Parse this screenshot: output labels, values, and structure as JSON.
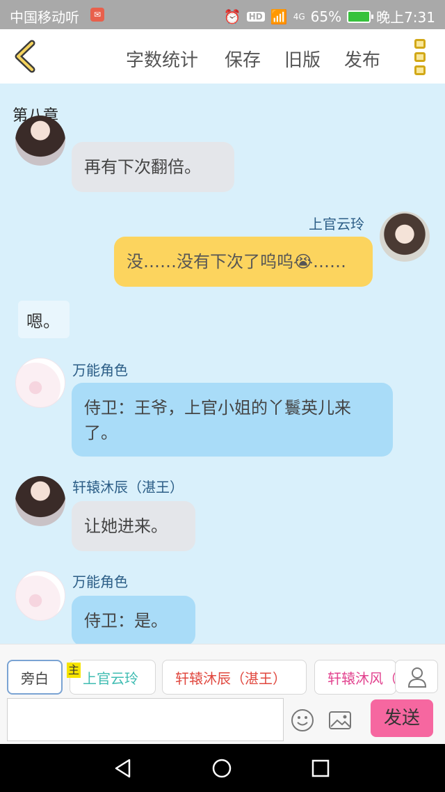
{
  "status_bar": {
    "carrier": "中国移动听",
    "hd": "HD",
    "network": "4G",
    "battery": "65%",
    "time": "晚上7:31"
  },
  "header": {
    "actions": [
      "字数统计",
      "保存",
      "旧版",
      "发布"
    ]
  },
  "chapter_title": "第八章",
  "messages": [
    {
      "text": "再有下次翻倍。"
    },
    {
      "name": "上官云玲",
      "text": "没……没有下次了呜呜😭……"
    },
    {
      "text": "嗯。"
    },
    {
      "name": "万能角色",
      "text": "侍卫：王爷，上官小姐的丫鬟英儿来了。"
    },
    {
      "name": "轩辕沐辰（湛王）",
      "text": "让她进来。"
    },
    {
      "name": "万能角色",
      "text": "侍卫：是。"
    }
  ],
  "roles": [
    {
      "label": "旁白"
    },
    {
      "label": "上官云玲",
      "tag": "主",
      "color": "#3fbcb2"
    },
    {
      "label": "轩辕沐辰（湛王）",
      "color": "#e0473e"
    },
    {
      "label": "轩辕沐风（",
      "color": "#e2438f"
    }
  ],
  "input": {
    "value": "",
    "send_label": "发送"
  },
  "colors": {
    "background": "#d9f0fb",
    "send": "#f667a0",
    "name": "#2b5d86"
  }
}
